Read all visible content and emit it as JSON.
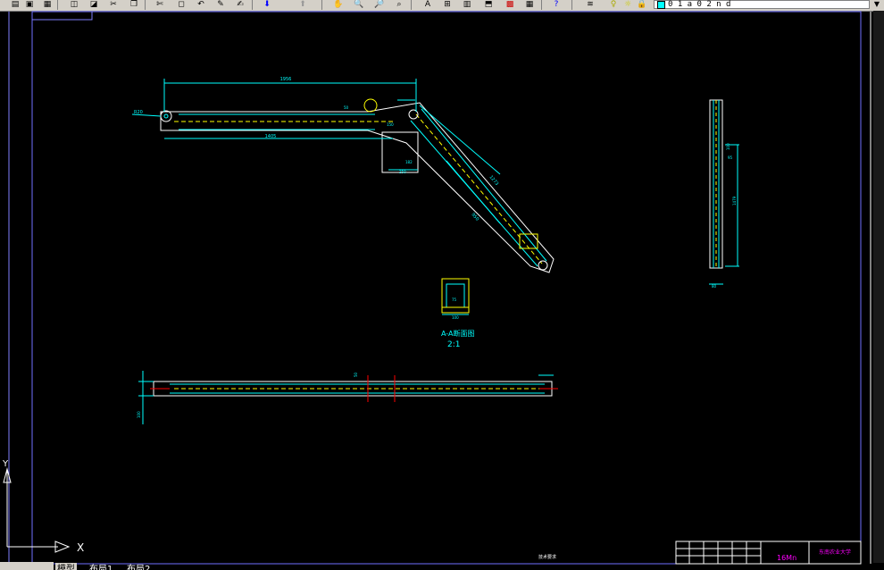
{
  "toolbar": {
    "icons": [
      "open-icon",
      "save-icon",
      "print-icon",
      "preview-icon",
      "publish-icon",
      "cut-icon",
      "copy-icon",
      "paste-icon",
      "match-properties-icon",
      "undo-icon",
      "redo-icon",
      "pan-icon",
      "zoom-realtime-icon",
      "zoom-window-icon",
      "zoom-previous-icon",
      "properties-icon",
      "design-center-icon",
      "tool-palettes-icon",
      "sheet-set-icon",
      "markup-icon",
      "calculator-icon",
      "help-icon",
      "layer-manager-icon",
      "layer-state-icon"
    ],
    "layer_value": "0 1 a 0 2 n d",
    "layer_arrow": "▼",
    "colors": {
      "face": "#d4d0c8",
      "cyan": "#00ffff",
      "yellow": "#ffff00",
      "magenta": "#ff00ff",
      "red": "#ff0000"
    }
  },
  "drawing": {
    "dim_overall_top": "1956",
    "dim_bottom": "1405",
    "dim_angle_label": "R20",
    "dim_small_1": "50",
    "dim_small_2": "150",
    "dim_small_3": "182",
    "dim_small_4": "250",
    "dim_diag_upper": "1273",
    "dim_diag_lower": "950",
    "dim_side_width": "95",
    "dim_side_length": "1479",
    "dim_side_small": "100",
    "dim_side_bottom": "80",
    "dim_plan_left": "100",
    "dim_plan_small": "50",
    "section_inner": "75",
    "section_outer": "100",
    "section_title": "A-A断面图",
    "section_scale": "2:1",
    "material": "16Mn",
    "school": "东南农业大学",
    "note_label": "技术要求"
  },
  "ucs": {
    "y_label": "Y",
    "x_label": "X"
  },
  "tabs": [
    "模型",
    "布局1",
    "布局2"
  ]
}
